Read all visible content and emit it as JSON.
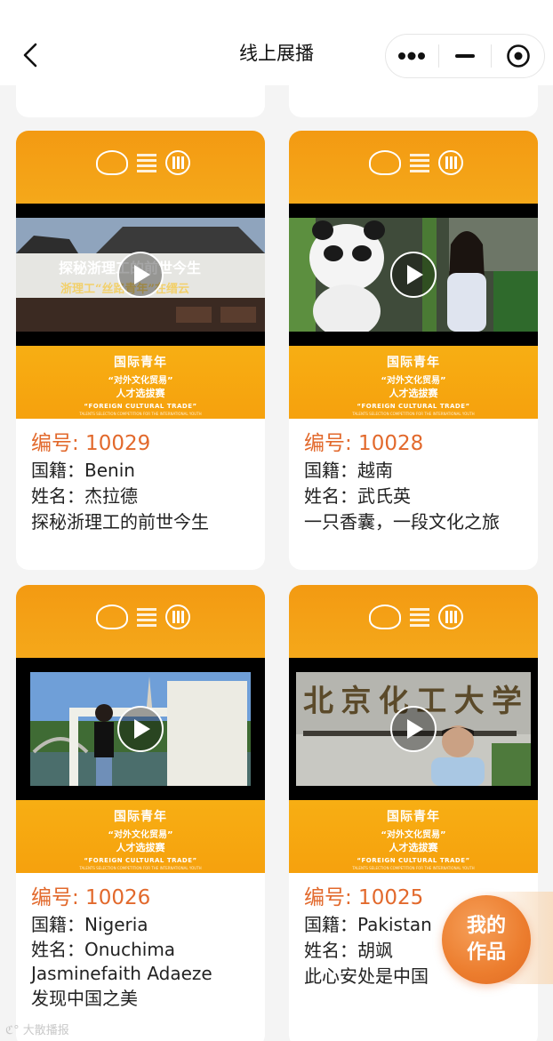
{
  "nav": {
    "title": "线上展播"
  },
  "cards": [
    {
      "id_label": "编号: 10029",
      "nationality": "国籍：Benin",
      "name": "姓名：杰拉德",
      "title": "探秘浙理工的前世今生",
      "video_caption_main": "探秘浙理工的前世今生",
      "video_caption_sub": "浙理工“丝路青年”在缙云"
    },
    {
      "id_label": "编号: 10028",
      "nationality": "国籍：越南",
      "name": "姓名：武氏英",
      "title": "一只香囊，一段文化之旅"
    },
    {
      "id_label": "编号: 10026",
      "nationality": "国籍：Nigeria",
      "name": "姓名：Onuchima Jasminefaith Adaeze",
      "title": "发现中国之美"
    },
    {
      "id_label": "编号: 10025",
      "nationality": "国籍：Pakistan",
      "name": "姓名：胡飒",
      "title": "此心安处是中国",
      "video_caption_main": "北京化工大学"
    }
  ],
  "banner": {
    "line1": "国际青年",
    "line2": "“对外文化贸易”",
    "line3": "人才选拔赛",
    "line4": "“FOREIGN CULTURAL TRADE”",
    "line5": "TALENTS SELECTION COMPETITION FOR THE INTERNATIONAL YOUTH"
  },
  "fab": {
    "line1": "我的",
    "line2": "作品"
  },
  "watermark": "大散播报",
  "colors": {
    "accent": "#e2692c",
    "banner": "#f5a81a"
  }
}
